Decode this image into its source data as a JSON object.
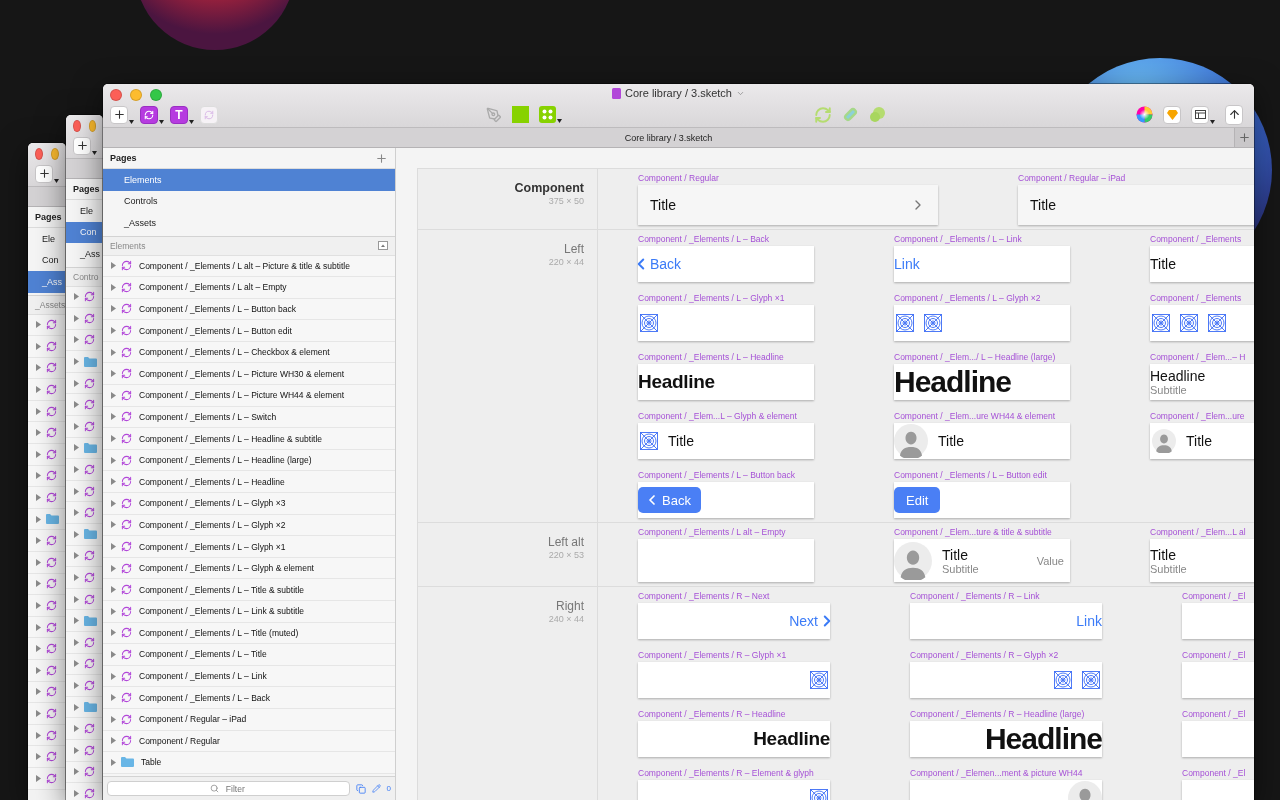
{
  "background_windows": [
    {
      "pages": [
        {
          "label": "Ele",
          "selected": false
        },
        {
          "label": "Con",
          "selected": false
        },
        {
          "label": "_Ass",
          "selected": true
        }
      ],
      "pages_title": "Pages",
      "layers_title": "_Assets",
      "layers": [
        {
          "kind": "symbol"
        },
        {
          "kind": "symbol"
        },
        {
          "kind": "symbol"
        },
        {
          "kind": "symbol"
        },
        {
          "kind": "symbol"
        },
        {
          "kind": "symbol"
        },
        {
          "kind": "symbol"
        },
        {
          "kind": "symbol"
        },
        {
          "kind": "symbol"
        },
        {
          "kind": "folder"
        },
        {
          "kind": "symbol"
        },
        {
          "kind": "symbol"
        },
        {
          "kind": "symbol"
        },
        {
          "kind": "symbol"
        },
        {
          "kind": "symbol"
        },
        {
          "kind": "symbol"
        },
        {
          "kind": "symbol"
        },
        {
          "kind": "symbol"
        },
        {
          "kind": "symbol"
        },
        {
          "kind": "symbol"
        },
        {
          "kind": "symbol"
        },
        {
          "kind": "symbol"
        }
      ]
    },
    {
      "pages": [
        {
          "label": "Ele",
          "selected": false
        },
        {
          "label": "Con",
          "selected": true
        },
        {
          "label": "_Ass",
          "selected": false
        }
      ],
      "pages_title": "Pages",
      "layers_title": "Contro",
      "layers": [
        {
          "kind": "symbol"
        },
        {
          "kind": "symbol"
        },
        {
          "kind": "symbol"
        },
        {
          "kind": "folder"
        },
        {
          "kind": "symbol"
        },
        {
          "kind": "symbol"
        },
        {
          "kind": "symbol"
        },
        {
          "kind": "folder"
        },
        {
          "kind": "symbol"
        },
        {
          "kind": "symbol"
        },
        {
          "kind": "symbol"
        },
        {
          "kind": "folder"
        },
        {
          "kind": "symbol"
        },
        {
          "kind": "symbol"
        },
        {
          "kind": "symbol"
        },
        {
          "kind": "folder"
        },
        {
          "kind": "symbol"
        },
        {
          "kind": "symbol"
        },
        {
          "kind": "symbol"
        },
        {
          "kind": "folder"
        },
        {
          "kind": "symbol"
        },
        {
          "kind": "symbol"
        },
        {
          "kind": "symbol"
        },
        {
          "kind": "symbol"
        }
      ]
    }
  ],
  "window": {
    "title": "Core library / 3.sketch",
    "tab": "Core library / 3.sketch",
    "text_tool": "T"
  },
  "sidebar": {
    "pages_title": "Pages",
    "pages": [
      {
        "label": "Elements",
        "selected": true
      },
      {
        "label": "Controls",
        "selected": false
      },
      {
        "label": "_Assets",
        "selected": false
      }
    ],
    "layers_title": "Elements",
    "layers": [
      {
        "kind": "symbol",
        "label": "Component / _Elements / L alt – Picture & title & subtitle"
      },
      {
        "kind": "symbol",
        "label": "Component / _Elements / L alt – Empty"
      },
      {
        "kind": "symbol",
        "label": "Component / _Elements / L – Button back"
      },
      {
        "kind": "symbol",
        "label": "Component / _Elements / L – Button edit"
      },
      {
        "kind": "symbol",
        "label": "Component / _Elements / L – Checkbox & element"
      },
      {
        "kind": "symbol",
        "label": "Component / _Elements / L – Picture WH30 & element"
      },
      {
        "kind": "symbol",
        "label": "Component / _Elements / L – Picture WH44 & element"
      },
      {
        "kind": "symbol",
        "label": "Component / _Elements / L – Switch"
      },
      {
        "kind": "symbol",
        "label": "Component / _Elements / L – Headline & subtitle"
      },
      {
        "kind": "symbol",
        "label": "Component / _Elements / L – Headline (large)"
      },
      {
        "kind": "symbol",
        "label": "Component / _Elements / L – Headline"
      },
      {
        "kind": "symbol",
        "label": "Component / _Elements / L – Glyph ×3"
      },
      {
        "kind": "symbol",
        "label": "Component / _Elements / L – Glyph ×2"
      },
      {
        "kind": "symbol",
        "label": "Component / _Elements / L – Glyph ×1"
      },
      {
        "kind": "symbol",
        "label": "Component / _Elements / L – Glyph & element"
      },
      {
        "kind": "symbol",
        "label": "Component / _Elements / L – Title & subtitle"
      },
      {
        "kind": "symbol",
        "label": "Component / _Elements / L – Link & subtitle"
      },
      {
        "kind": "symbol",
        "label": "Component / _Elements / L – Title (muted)"
      },
      {
        "kind": "symbol",
        "label": "Component / _Elements / L – Title"
      },
      {
        "kind": "symbol",
        "label": "Component / _Elements / L – Link"
      },
      {
        "kind": "symbol",
        "label": "Component / _Elements / L – Back"
      },
      {
        "kind": "symbol",
        "label": "Component / Regular – iPad"
      },
      {
        "kind": "symbol",
        "label": "Component / Regular"
      },
      {
        "kind": "folder",
        "label": "Table"
      }
    ],
    "filter": {
      "placeholder": "Filter"
    },
    "edit_count": "0"
  },
  "canvas": {
    "sections": [
      {
        "kind": "regular",
        "title": "Component",
        "size": "375 × 50",
        "columns": [
          [
            {
              "label": "Component / Regular",
              "kind": "regular",
              "text": "Title",
              "chevron": true
            }
          ],
          [
            {
              "label": "Component / Regular – iPad",
              "kind": "regular",
              "text": "Title"
            }
          ]
        ]
      },
      {
        "kind": "left",
        "title": "Left",
        "size": "220 × 44",
        "columns": [
          [
            {
              "label": "Component / _Elements / L – Back",
              "kind": "back",
              "text": "Back"
            },
            {
              "label": "Component / _Elements / L – Glyph ×1",
              "kind": "glyph1"
            },
            {
              "label": "Component / _Elements / L – Headline",
              "kind": "headline",
              "text": "Headline"
            },
            {
              "label": "Component / _Elem...L – Glyph & element",
              "kind": "glyphtitle",
              "text": "Title"
            },
            {
              "label": "Component / _Elements / L – Button back",
              "kind": "buttonback",
              "text": "Back"
            }
          ],
          [
            {
              "label": "Component / _Elements / L – Link",
              "kind": "link",
              "text": "Link"
            },
            {
              "label": "Component / _Elements / L – Glyph ×2",
              "kind": "glyph2"
            },
            {
              "label": "Component / _Elem.../ L – Headline (large)",
              "kind": "headlinelarge",
              "text": "Headline"
            },
            {
              "label": "Component / _Elem...ure WH44 & element",
              "kind": "avatar44",
              "text": "Title"
            },
            {
              "label": "Component / _Elements / L – Button edit",
              "kind": "buttonedit",
              "text": "Edit"
            }
          ],
          [
            {
              "label": "Component / _Elements",
              "kind": "title",
              "text": "Title"
            },
            {
              "label": "Component / _Elements",
              "kind": "glyph3"
            },
            {
              "label": "Component / _Elem...– H",
              "kind": "headsub",
              "text": "Headline",
              "subtitle": "Subtitle"
            },
            {
              "label": "Component / _Elem...ure",
              "kind": "avatar30",
              "text": "Title"
            }
          ]
        ]
      },
      {
        "kind": "leftalt",
        "title": "Left alt",
        "size": "220 × 53",
        "columns": [
          [
            {
              "label": "Component / _Elements / L alt – Empty",
              "kind": "empty"
            }
          ],
          [
            {
              "label": "Component / _Elem...ture & title & subtitle",
              "kind": "profile",
              "text": "Title",
              "subtitle": "Subtitle",
              "value": "Value"
            }
          ],
          [
            {
              "label": "Component / _Elem...L al",
              "kind": "titlesub",
              "text": "Title",
              "subtitle": "Subtitle"
            }
          ]
        ]
      },
      {
        "kind": "right",
        "title": "Right",
        "size": "240 × 44",
        "columns": [
          [
            {
              "label": "Component / _Elements / R – Next",
              "kind": "next",
              "text": "Next"
            },
            {
              "label": "Component / _Elements / R – Glyph ×1",
              "kind": "glyph1"
            },
            {
              "label": "Component / _Elements / R – Headline",
              "kind": "headline",
              "text": "Headline"
            },
            {
              "label": "Component / _Elements / R – Element & glyph",
              "kind": "glyph1"
            }
          ],
          [
            {
              "label": "Component / _Elements / R – Link",
              "kind": "link",
              "text": "Link"
            },
            {
              "label": "Component / _Elements / R – Glyph ×2",
              "kind": "glyph2"
            },
            {
              "label": "Component / _Elements / R – Headline (large)",
              "kind": "headlinelarge",
              "text": "Headline"
            },
            {
              "label": "Component / _Elemen...ment & picture WH44",
              "kind": "avatar44"
            }
          ],
          [
            {
              "label": "Component / _El",
              "kind": "empty"
            },
            {
              "label": "Component / _El",
              "kind": "empty"
            },
            {
              "label": "Component / _El",
              "kind": "empty"
            },
            {
              "label": "Component / _El",
              "kind": "empty"
            }
          ]
        ]
      }
    ]
  }
}
